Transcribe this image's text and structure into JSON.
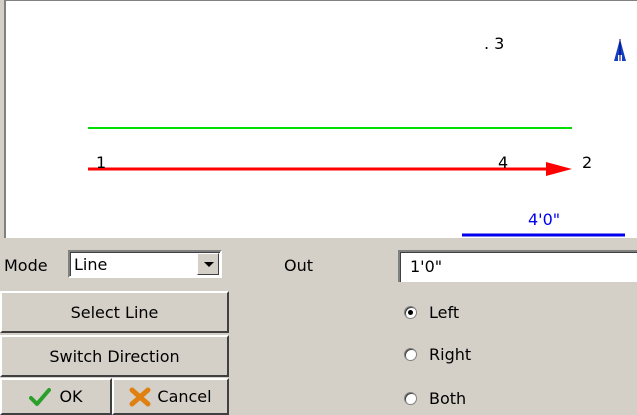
{
  "canvas": {
    "point_labels": [
      "1",
      "2",
      ". 3",
      "4"
    ],
    "dimension_label": "4'0\"",
    "colors": {
      "guide": "#00dd00",
      "line": "#ff0000",
      "dimension": "#0000ee",
      "north": "#1040c0"
    },
    "icons": [
      "north-arrow-icon"
    ]
  },
  "controls": {
    "mode_label": "Mode",
    "mode_value": "Line",
    "out_label": "Out",
    "out_value": "1'0\"",
    "select_line_label": "Select Line",
    "switch_direction_label": "Switch Direction",
    "ok_label": "OK",
    "cancel_label": "Cancel",
    "side_options": [
      {
        "label": "Left",
        "selected": true
      },
      {
        "label": "Right",
        "selected": false
      },
      {
        "label": "Both",
        "selected": false
      }
    ]
  }
}
